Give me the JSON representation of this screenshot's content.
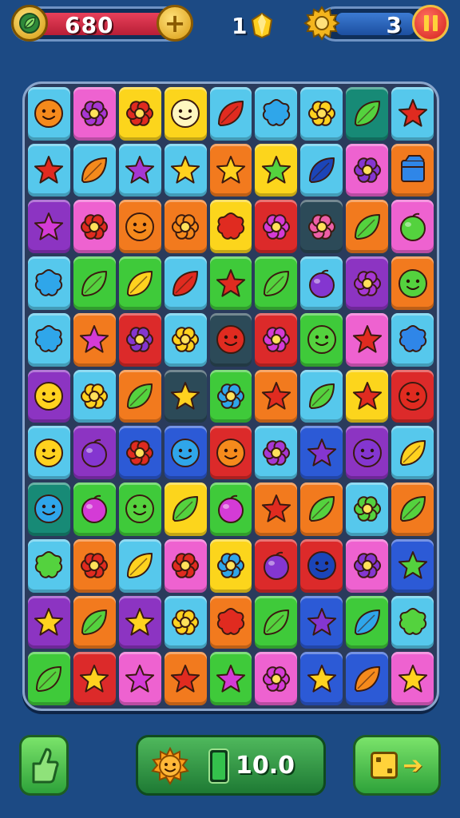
{
  "hud": {
    "coins": "680",
    "gems": "1",
    "level": "3",
    "colors": {
      "coin_bar": "#d22a44",
      "level_bar": "#2a62b8",
      "gold": "#f3b51d"
    }
  },
  "icons": {
    "coin": "leaf-coin-icon",
    "add": "plus-icon",
    "gem": "gem-icon",
    "settings": "gear-icon",
    "pause": "pause-icon",
    "hint": "thumbs-up-icon",
    "booster": "sun-face-icon",
    "next": "dice-arrow-icon"
  },
  "board": {
    "rows": 11,
    "cols": 9,
    "tile_colors": {
      "L": "#56c8ec",
      "P": "#ee62d0",
      "Y": "#fcd51c",
      "G": "#3fca3a",
      "O": "#f27a1e",
      "R": "#dc2a2a",
      "V": "#8c34c2",
      "T": "#178a76",
      "D": "#2c4a58",
      "B": "#2c5ad6"
    },
    "icon_colors": {
      "o": "#f58a1c",
      "p": "#a637d3",
      "r": "#e02b20",
      "w": "#fff7c0",
      "b": "#2f86e8",
      "l": "#2fa6ea",
      "y": "#ffd21f",
      "g": "#54d23e",
      "m": "#8436d0",
      "n": "#d43bd6",
      "k": "#ee5fa7",
      "u": "#1b45b8",
      "c": "#77d8f4"
    },
    "tiles": [
      [
        [
          "L",
          "face",
          "o"
        ],
        [
          "P",
          "flower",
          "p"
        ],
        [
          "Y",
          "flower",
          "r"
        ],
        [
          "Y",
          "face",
          "w"
        ],
        [
          "L",
          "leaf",
          "r"
        ],
        [
          "L",
          "splat",
          "l"
        ],
        [
          "L",
          "flower",
          "y"
        ],
        [
          "T",
          "leaf",
          "g"
        ],
        [
          "L",
          "star",
          "r"
        ]
      ],
      [
        [
          "L",
          "star",
          "r"
        ],
        [
          "L",
          "leaf",
          "o"
        ],
        [
          "L",
          "star",
          "p"
        ],
        [
          "L",
          "star",
          "y"
        ],
        [
          "O",
          "star",
          "y"
        ],
        [
          "Y",
          "star",
          "g"
        ],
        [
          "L",
          "leaf",
          "u"
        ],
        [
          "P",
          "flower",
          "m"
        ],
        [
          "O",
          "box",
          "b"
        ]
      ],
      [
        [
          "V",
          "star",
          "n"
        ],
        [
          "P",
          "flower",
          "r"
        ],
        [
          "O",
          "face",
          "o"
        ],
        [
          "O",
          "flower",
          "o"
        ],
        [
          "Y",
          "splat",
          "r"
        ],
        [
          "R",
          "flower",
          "n"
        ],
        [
          "D",
          "flower",
          "k"
        ],
        [
          "O",
          "leaf",
          "g"
        ],
        [
          "P",
          "fruit",
          "g"
        ]
      ],
      [
        [
          "L",
          "splat",
          "l"
        ],
        [
          "G",
          "leaf",
          "g"
        ],
        [
          "G",
          "leaf",
          "y"
        ],
        [
          "L",
          "leaf",
          "r"
        ],
        [
          "G",
          "star",
          "r"
        ],
        [
          "G",
          "leaf",
          "g"
        ],
        [
          "L",
          "fruit",
          "m"
        ],
        [
          "V",
          "flower",
          "p"
        ],
        [
          "O",
          "face",
          "g"
        ]
      ],
      [
        [
          "L",
          "splat",
          "l"
        ],
        [
          "O",
          "star",
          "n"
        ],
        [
          "R",
          "flower",
          "m"
        ],
        [
          "L",
          "flower",
          "y"
        ],
        [
          "D",
          "face",
          "r"
        ],
        [
          "R",
          "flower",
          "n"
        ],
        [
          "G",
          "face",
          "g"
        ],
        [
          "P",
          "star",
          "r"
        ],
        [
          "L",
          "splat",
          "b"
        ]
      ],
      [
        [
          "V",
          "face",
          "y"
        ],
        [
          "L",
          "flower",
          "y"
        ],
        [
          "O",
          "leaf",
          "g"
        ],
        [
          "D",
          "star",
          "y"
        ],
        [
          "G",
          "flower",
          "l"
        ],
        [
          "O",
          "star",
          "r"
        ],
        [
          "L",
          "leaf",
          "g"
        ],
        [
          "Y",
          "star",
          "r"
        ],
        [
          "R",
          "face",
          "r"
        ]
      ],
      [
        [
          "L",
          "face",
          "y"
        ],
        [
          "V",
          "fruit",
          "m"
        ],
        [
          "B",
          "flower",
          "r"
        ],
        [
          "B",
          "face",
          "l"
        ],
        [
          "R",
          "face",
          "o"
        ],
        [
          "L",
          "flower",
          "p"
        ],
        [
          "B",
          "star",
          "m"
        ],
        [
          "V",
          "face",
          "m"
        ],
        [
          "L",
          "leaf",
          "y"
        ]
      ],
      [
        [
          "T",
          "face",
          "l"
        ],
        [
          "G",
          "fruit",
          "n"
        ],
        [
          "G",
          "face",
          "g"
        ],
        [
          "Y",
          "leaf",
          "g"
        ],
        [
          "G",
          "fruit",
          "n"
        ],
        [
          "O",
          "star",
          "r"
        ],
        [
          "O",
          "leaf",
          "g"
        ],
        [
          "L",
          "flower",
          "g"
        ],
        [
          "O",
          "leaf",
          "g"
        ]
      ],
      [
        [
          "L",
          "splat",
          "g"
        ],
        [
          "O",
          "flower",
          "r"
        ],
        [
          "L",
          "leaf",
          "y"
        ],
        [
          "P",
          "flower",
          "r"
        ],
        [
          "Y",
          "flower",
          "l"
        ],
        [
          "R",
          "fruit",
          "m"
        ],
        [
          "R",
          "face",
          "u"
        ],
        [
          "P",
          "flower",
          "m"
        ],
        [
          "B",
          "star",
          "g"
        ]
      ],
      [
        [
          "V",
          "star",
          "y"
        ],
        [
          "O",
          "leaf",
          "g"
        ],
        [
          "V",
          "star",
          "y"
        ],
        [
          "L",
          "flower",
          "y"
        ],
        [
          "O",
          "splat",
          "r"
        ],
        [
          "G",
          "leaf",
          "g"
        ],
        [
          "B",
          "star",
          "m"
        ],
        [
          "G",
          "leaf",
          "l"
        ],
        [
          "L",
          "splat",
          "g"
        ]
      ],
      [
        [
          "G",
          "leaf",
          "g"
        ],
        [
          "R",
          "star",
          "y"
        ],
        [
          "P",
          "star",
          "n"
        ],
        [
          "O",
          "star",
          "r"
        ],
        [
          "G",
          "star",
          "n"
        ],
        [
          "P",
          "flower",
          "n"
        ],
        [
          "B",
          "star",
          "y"
        ],
        [
          "B",
          "leaf",
          "o"
        ],
        [
          "P",
          "star",
          "y"
        ]
      ]
    ]
  },
  "footer": {
    "booster_value": "10.0",
    "booster_level": 1.0
  }
}
